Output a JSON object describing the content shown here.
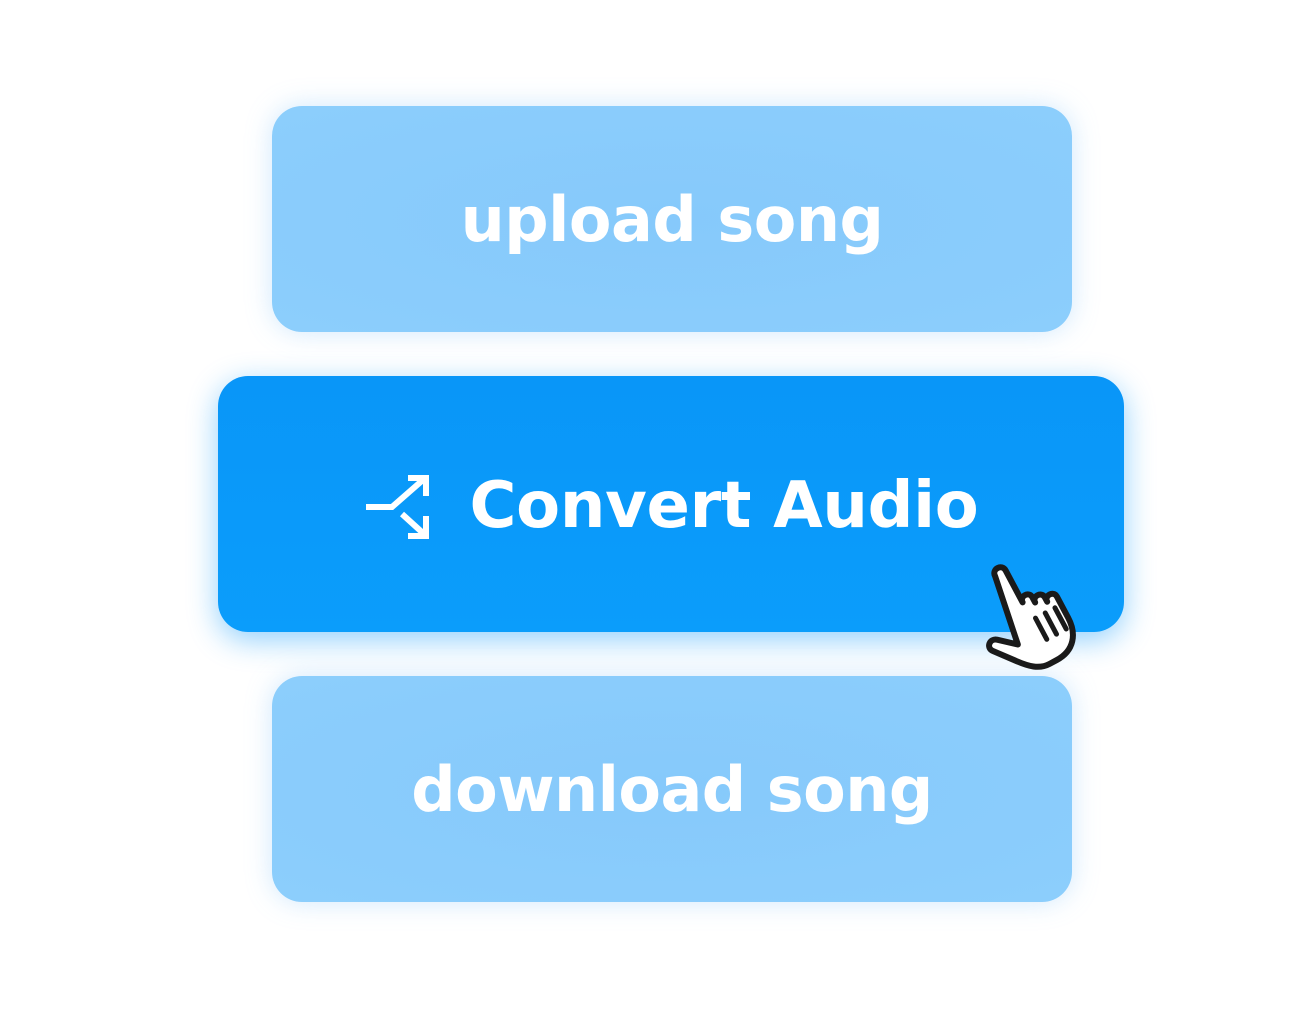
{
  "buttons": {
    "upload_label": "upload song",
    "convert_label": "Convert Audio",
    "download_label": "download song"
  },
  "icons": {
    "convert": "shuffle-icon",
    "cursor": "hand-pointer-icon"
  },
  "colors": {
    "primary": "#0a99fa",
    "secondary": "#88cbfb",
    "text": "#ffffff"
  }
}
